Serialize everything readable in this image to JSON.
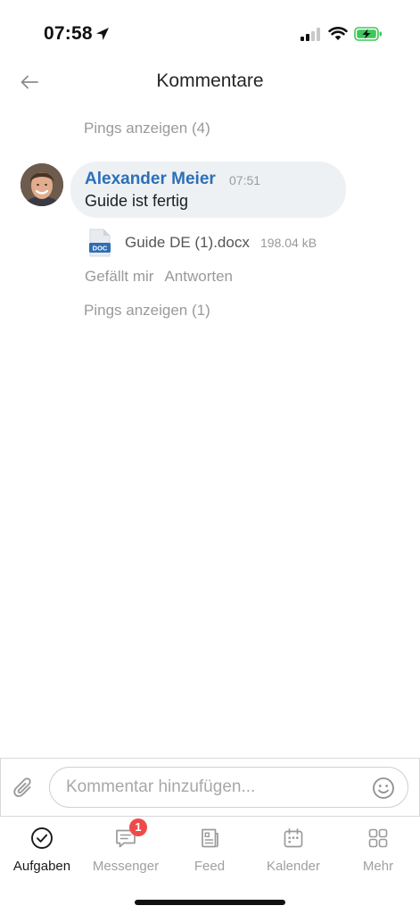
{
  "status_bar": {
    "time": "07:58",
    "icons": [
      "location-arrow-icon",
      "cellular-signal-icon",
      "wifi-icon",
      "battery-charging-icon"
    ],
    "battery_color": "#3cc75a"
  },
  "header": {
    "title": "Kommentare",
    "back_icon": "back-arrow-icon"
  },
  "comments": {
    "pings_top": "Pings anzeigen (4)",
    "item": {
      "author": "Alexander Meier",
      "time": "07:51",
      "text": "Guide ist fertig",
      "author_color": "#2c6fb7",
      "attachment": {
        "icon": "doc-file-icon",
        "icon_label": "DOC",
        "name": "Guide DE (1).docx",
        "size": "198.04 kB"
      },
      "actions": {
        "like": "Gefällt mir",
        "reply": "Antworten"
      }
    },
    "pings_bottom": "Pings anzeigen (1)"
  },
  "composer": {
    "placeholder": "Kommentar hinzufügen...",
    "attach_icon": "paperclip-icon",
    "emoji_icon": "smiley-icon"
  },
  "tabbar": {
    "tabs": [
      {
        "label": "Aufgaben",
        "icon": "checkmark-circle-icon",
        "active": true
      },
      {
        "label": "Messenger",
        "icon": "chat-bubble-icon",
        "badge": "1"
      },
      {
        "label": "Feed",
        "icon": "feed-icon"
      },
      {
        "label": "Kalender",
        "icon": "calendar-icon"
      },
      {
        "label": "Mehr",
        "icon": "grid-icon"
      }
    ],
    "badge_color": "#ef4a4a"
  }
}
